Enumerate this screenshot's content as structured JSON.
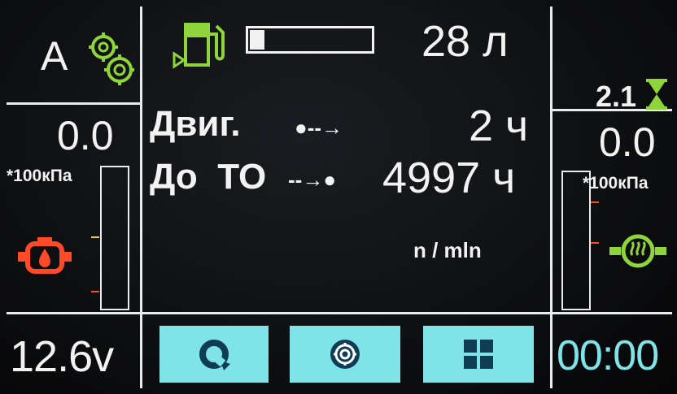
{
  "left": {
    "gear_mode": "A",
    "pressure_value": "0.0",
    "pressure_unit": "*100кПа",
    "voltage": "12.6v",
    "gauge_level": 0.0
  },
  "center": {
    "fuel_level_fraction": 0.12,
    "fuel_value": "28 л",
    "engine_label": "Двиг.",
    "engine_arrow": "●--→",
    "engine_hours": "2 ч",
    "service_label": "До  ТО",
    "service_arrow": "--→●",
    "service_hours": "4997 ч",
    "rpm_unit": "n / mln"
  },
  "right": {
    "timer_value": "2.1",
    "pressure_value": "0.0",
    "pressure_unit": "*100кПа",
    "clock": "00:00",
    "gauge_level": 0.0
  },
  "buttons": [
    {
      "icon": "refresh-icon"
    },
    {
      "icon": "gear-icon"
    },
    {
      "icon": "grid-icon"
    }
  ],
  "colors": {
    "green": "#8fd43a",
    "red": "#ff4a2a",
    "cyan": "#7fe3e8",
    "white": "#f2f2f2"
  }
}
